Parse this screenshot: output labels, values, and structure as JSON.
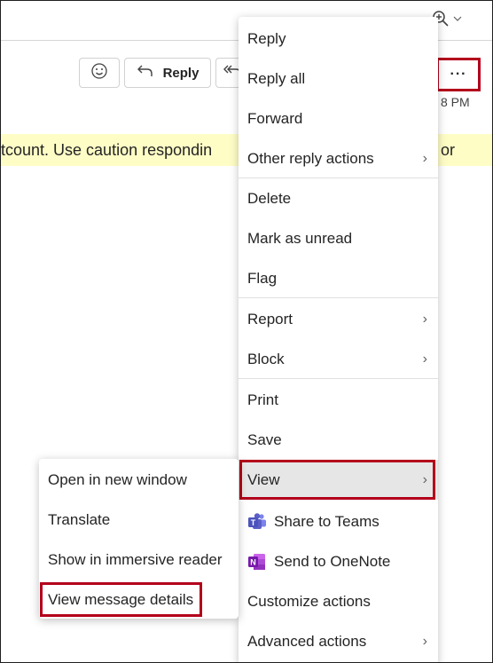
{
  "toolbar": {
    "reply_label": "Reply",
    "more_label": "···"
  },
  "message": {
    "time_fragment": "8 PM",
    "banner_left": "tcount. Use caution respondin",
    "banner_right": "or"
  },
  "menu": {
    "items": [
      {
        "label": "Reply"
      },
      {
        "label": "Reply all"
      },
      {
        "label": "Forward"
      },
      {
        "label": "Other reply actions"
      },
      {
        "label": "Delete"
      },
      {
        "label": "Mark as unread"
      },
      {
        "label": "Flag"
      },
      {
        "label": "Report"
      },
      {
        "label": "Block"
      },
      {
        "label": "Print"
      },
      {
        "label": "Save"
      },
      {
        "label": "View"
      },
      {
        "label": "Share to Teams"
      },
      {
        "label": "Send to OneNote"
      },
      {
        "label": "Customize actions"
      },
      {
        "label": "Advanced actions"
      }
    ]
  },
  "submenu": {
    "items": [
      {
        "label": "Open in new window"
      },
      {
        "label": "Translate"
      },
      {
        "label": "Show in immersive reader"
      },
      {
        "label": "View message details"
      }
    ]
  },
  "colors": {
    "highlight": "#b3001b",
    "banner": "#fffdc6",
    "teams": "#5b5fc7",
    "onenote": "#7719aa"
  },
  "icons": [
    "zoom-in-icon",
    "chevron-down-icon",
    "emoji-icon",
    "reply-icon",
    "reply-all-icon",
    "teams-icon",
    "onenote-icon",
    "chevron-right-icon"
  ]
}
